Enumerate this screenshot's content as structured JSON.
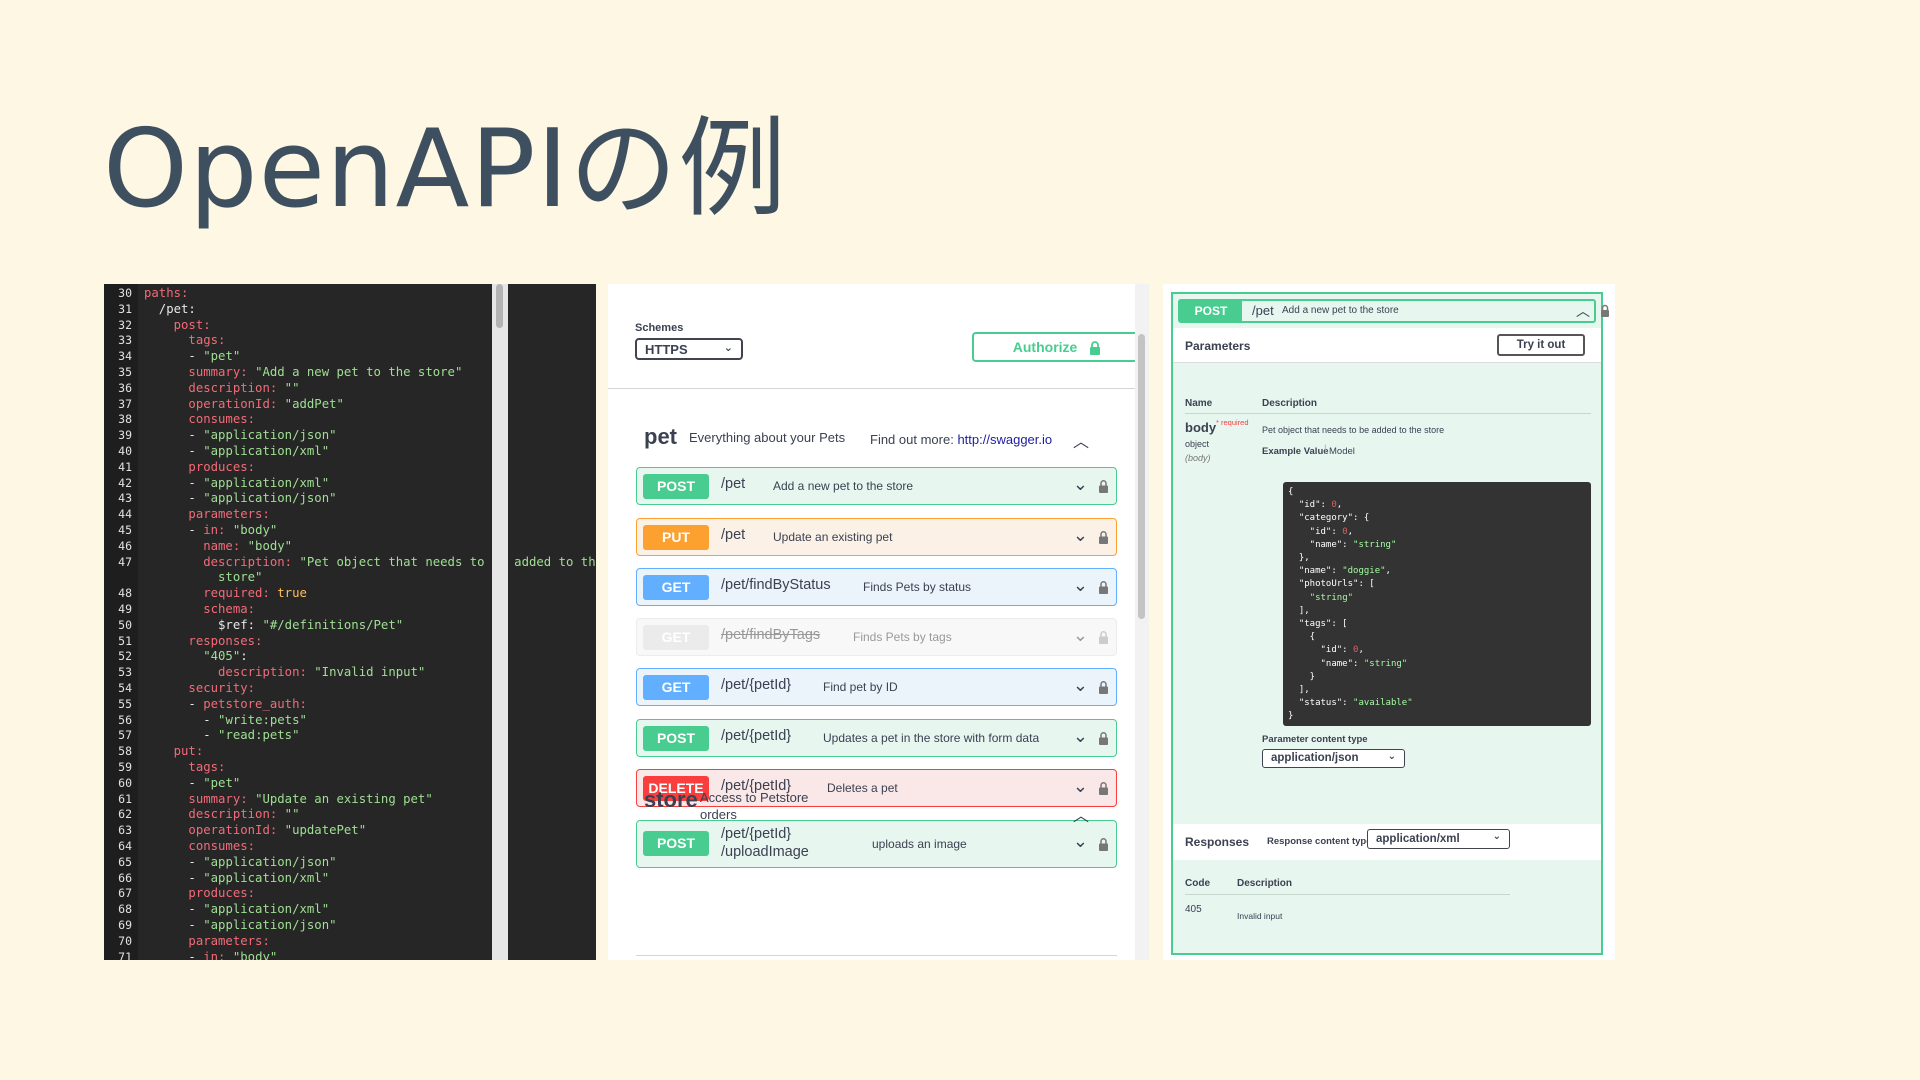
{
  "slide": {
    "title": "OpenAPIの例"
  },
  "yaml_editor": {
    "lines": [
      {
        "n": "30",
        "parts": [
          [
            "k",
            "paths:"
          ]
        ]
      },
      {
        "n": "31",
        "parts": [
          [
            "p",
            "  /pet:"
          ]
        ]
      },
      {
        "n": "32",
        "parts": [
          [
            "k",
            "    post:"
          ]
        ]
      },
      {
        "n": "33",
        "parts": [
          [
            "k",
            "      tags:"
          ]
        ]
      },
      {
        "n": "34",
        "parts": [
          [
            "p",
            "      - "
          ],
          [
            "s",
            "\"pet\""
          ]
        ]
      },
      {
        "n": "35",
        "parts": [
          [
            "k",
            "      summary: "
          ],
          [
            "s",
            "\"Add a new pet to the store\""
          ]
        ]
      },
      {
        "n": "36",
        "parts": [
          [
            "k",
            "      description: "
          ],
          [
            "s",
            "\"\""
          ]
        ]
      },
      {
        "n": "37",
        "parts": [
          [
            "k",
            "      operationId: "
          ],
          [
            "s",
            "\"addPet\""
          ]
        ]
      },
      {
        "n": "38",
        "parts": [
          [
            "k",
            "      consumes:"
          ]
        ]
      },
      {
        "n": "39",
        "parts": [
          [
            "p",
            "      - "
          ],
          [
            "s",
            "\"application/json\""
          ]
        ]
      },
      {
        "n": "40",
        "parts": [
          [
            "p",
            "      - "
          ],
          [
            "s",
            "\"application/xml\""
          ]
        ]
      },
      {
        "n": "41",
        "parts": [
          [
            "k",
            "      produces:"
          ]
        ]
      },
      {
        "n": "42",
        "parts": [
          [
            "p",
            "      - "
          ],
          [
            "s",
            "\"application/xml\""
          ]
        ]
      },
      {
        "n": "43",
        "parts": [
          [
            "p",
            "      - "
          ],
          [
            "s",
            "\"application/json\""
          ]
        ]
      },
      {
        "n": "44",
        "parts": [
          [
            "k",
            "      parameters:"
          ]
        ]
      },
      {
        "n": "45",
        "parts": [
          [
            "p",
            "      - "
          ],
          [
            "k",
            "in: "
          ],
          [
            "s",
            "\"body\""
          ]
        ]
      },
      {
        "n": "46",
        "parts": [
          [
            "k",
            "        name: "
          ],
          [
            "s",
            "\"body\""
          ]
        ]
      },
      {
        "n": "47",
        "parts": [
          [
            "k",
            "        description: "
          ],
          [
            "s",
            "\"Pet object that needs to be added to the"
          ]
        ]
      },
      {
        "n": "",
        "parts": [
          [
            "s",
            "          store\""
          ]
        ]
      },
      {
        "n": "48",
        "parts": [
          [
            "k",
            "        required: "
          ],
          [
            "b",
            "true"
          ]
        ]
      },
      {
        "n": "49",
        "parts": [
          [
            "k",
            "        schema:"
          ]
        ]
      },
      {
        "n": "50",
        "parts": [
          [
            "p",
            "          $ref: "
          ],
          [
            "s",
            "\"#/definitions/Pet\""
          ]
        ]
      },
      {
        "n": "51",
        "parts": [
          [
            "k",
            "      responses:"
          ]
        ]
      },
      {
        "n": "52",
        "parts": [
          [
            "s",
            "        \"405\""
          ],
          [
            "p",
            ":"
          ]
        ]
      },
      {
        "n": "53",
        "parts": [
          [
            "k",
            "          description: "
          ],
          [
            "s",
            "\"Invalid input\""
          ]
        ]
      },
      {
        "n": "54",
        "parts": [
          [
            "k",
            "      security:"
          ]
        ]
      },
      {
        "n": "55",
        "parts": [
          [
            "p",
            "      - "
          ],
          [
            "k",
            "petstore_auth:"
          ]
        ]
      },
      {
        "n": "56",
        "parts": [
          [
            "p",
            "        - "
          ],
          [
            "s",
            "\"write:pets\""
          ]
        ]
      },
      {
        "n": "57",
        "parts": [
          [
            "p",
            "        - "
          ],
          [
            "s",
            "\"read:pets\""
          ]
        ]
      },
      {
        "n": "58",
        "parts": [
          [
            "k",
            "    put:"
          ]
        ]
      },
      {
        "n": "59",
        "parts": [
          [
            "k",
            "      tags:"
          ]
        ]
      },
      {
        "n": "60",
        "parts": [
          [
            "p",
            "      - "
          ],
          [
            "s",
            "\"pet\""
          ]
        ]
      },
      {
        "n": "61",
        "parts": [
          [
            "k",
            "      summary: "
          ],
          [
            "s",
            "\"Update an existing pet\""
          ]
        ]
      },
      {
        "n": "62",
        "parts": [
          [
            "k",
            "      description: "
          ],
          [
            "s",
            "\"\""
          ]
        ]
      },
      {
        "n": "63",
        "parts": [
          [
            "k",
            "      operationId: "
          ],
          [
            "s",
            "\"updatePet\""
          ]
        ]
      },
      {
        "n": "64",
        "parts": [
          [
            "k",
            "      consumes:"
          ]
        ]
      },
      {
        "n": "65",
        "parts": [
          [
            "p",
            "      - "
          ],
          [
            "s",
            "\"application/json\""
          ]
        ]
      },
      {
        "n": "66",
        "parts": [
          [
            "p",
            "      - "
          ],
          [
            "s",
            "\"application/xml\""
          ]
        ]
      },
      {
        "n": "67",
        "parts": [
          [
            "k",
            "      produces:"
          ]
        ]
      },
      {
        "n": "68",
        "parts": [
          [
            "p",
            "      - "
          ],
          [
            "s",
            "\"application/xml\""
          ]
        ]
      },
      {
        "n": "69",
        "parts": [
          [
            "p",
            "      - "
          ],
          [
            "s",
            "\"application/json\""
          ]
        ]
      },
      {
        "n": "70",
        "parts": [
          [
            "k",
            "      parameters:"
          ]
        ]
      },
      {
        "n": "71",
        "parts": [
          [
            "p",
            "      - "
          ],
          [
            "k",
            "in: "
          ],
          [
            "s",
            "\"body\""
          ]
        ]
      }
    ]
  },
  "swagger_ui": {
    "schemes_label": "Schemes",
    "schemes_value": "HTTPS",
    "authorize_label": "Authorize",
    "pet_tag": {
      "name": "pet",
      "description": "Everything about your Pets",
      "find_more": "Find out more:",
      "link": "http://swagger.io"
    },
    "operations": [
      {
        "method": "POST",
        "path": "/pet",
        "summary": "Add a new pet to the store",
        "kind": "post"
      },
      {
        "method": "PUT",
        "path": "/pet",
        "summary": "Update an existing pet",
        "kind": "put"
      },
      {
        "method": "GET",
        "path": "/pet/findByStatus",
        "summary": "Finds Pets by status",
        "kind": "get"
      },
      {
        "method": "GET",
        "path": "/pet/findByTags",
        "summary": "Finds Pets by tags",
        "kind": "dep"
      },
      {
        "method": "GET",
        "path": "/pet/{petId}",
        "summary": "Find pet by ID",
        "kind": "get"
      },
      {
        "method": "POST",
        "path": "/pet/{petId}",
        "summary": "Updates a pet in the store with form data",
        "kind": "post"
      },
      {
        "method": "DELETE",
        "path": "/pet/{petId}",
        "summary": "Deletes a pet",
        "kind": "del"
      },
      {
        "method": "POST",
        "path": "/pet/{petId}\n/uploadImage",
        "summary": "uploads an image",
        "kind": "post"
      }
    ],
    "store_tag": {
      "name": "store",
      "description": "Access to Petstore orders"
    }
  },
  "operation_detail": {
    "method": "POST",
    "path": "/pet",
    "summary": "Add a new pet to the store",
    "parameters_title": "Parameters",
    "try_it_out": "Try it out",
    "col_name": "Name",
    "col_description": "Description",
    "param_name": "body",
    "param_required": "* required",
    "param_type": "object",
    "param_in": "(body)",
    "param_description": "Pet object that needs to be added to the store",
    "example_value": "Example Value",
    "model": "Model",
    "example_json": [
      [
        [
          "p",
          "{"
        ]
      ],
      [
        [
          "p",
          "  \"id\": "
        ],
        [
          "n",
          "0"
        ],
        [
          "p",
          ","
        ]
      ],
      [
        [
          "p",
          "  \"category\": {"
        ]
      ],
      [
        [
          "p",
          "    \"id\": "
        ],
        [
          "n",
          "0"
        ],
        [
          "p",
          ","
        ]
      ],
      [
        [
          "p",
          "    \"name\": "
        ],
        [
          "s",
          "\"string\""
        ]
      ],
      [
        [
          "p",
          "  },"
        ]
      ],
      [
        [
          "p",
          "  \"name\": "
        ],
        [
          "s",
          "\"doggie\""
        ],
        [
          "p",
          ","
        ]
      ],
      [
        [
          "p",
          "  \"photoUrls\": ["
        ]
      ],
      [
        [
          "p",
          "    "
        ],
        [
          "s",
          "\"string\""
        ]
      ],
      [
        [
          "p",
          "  ],"
        ]
      ],
      [
        [
          "p",
          "  \"tags\": ["
        ]
      ],
      [
        [
          "p",
          "    {"
        ]
      ],
      [
        [
          "p",
          "      \"id\": "
        ],
        [
          "n",
          "0"
        ],
        [
          "p",
          ","
        ]
      ],
      [
        [
          "p",
          "      \"name\": "
        ],
        [
          "s",
          "\"string\""
        ]
      ],
      [
        [
          "p",
          "    }"
        ]
      ],
      [
        [
          "p",
          "  ],"
        ]
      ],
      [
        [
          "p",
          "  \"status\": "
        ],
        [
          "s",
          "\"available\""
        ]
      ],
      [
        [
          "p",
          "}"
        ]
      ]
    ],
    "param_content_type_label": "Parameter content type",
    "param_content_type": "application/json",
    "responses_title": "Responses",
    "response_content_type_label": "Response content type",
    "response_content_type": "application/xml",
    "col_code": "Code",
    "response_code": "405",
    "response_description": "Invalid input"
  }
}
